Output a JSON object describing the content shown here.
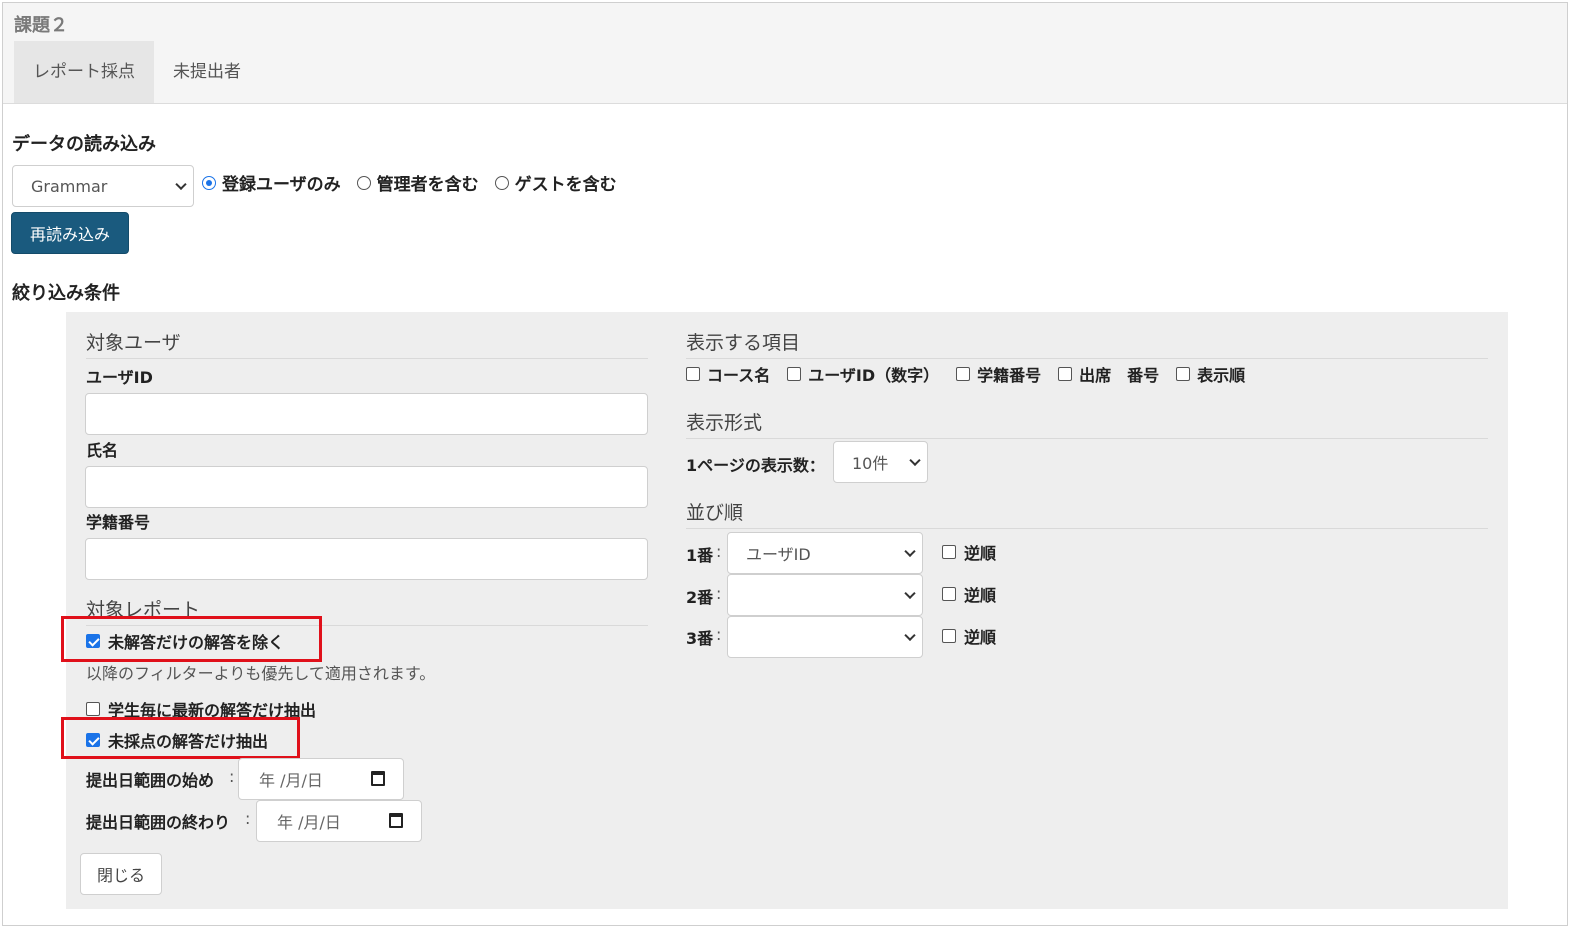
{
  "header": {
    "title": "課題２",
    "tabs": [
      {
        "label": "レポート採点",
        "active": true
      },
      {
        "label": "未提出者",
        "active": false
      }
    ]
  },
  "load": {
    "heading": "データの読み込み",
    "course_select": "Grammar",
    "radios": [
      {
        "label": "登録ユーザのみ",
        "checked": true
      },
      {
        "label": "管理者を含む",
        "checked": false
      },
      {
        "label": "ゲストを含む",
        "checked": false
      }
    ],
    "reload_button": "再読み込み"
  },
  "filter": {
    "heading": "絞り込み条件",
    "target_user": {
      "heading": "対象ユーザ",
      "user_id_label": "ユーザID",
      "user_id_value": "",
      "name_label": "氏名",
      "name_value": "",
      "student_no_label": "学籍番号",
      "student_no_value": ""
    },
    "target_report": {
      "heading": "対象レポート",
      "exclude_unanswered": {
        "label": "未解答だけの解答を除く",
        "checked": true
      },
      "note": "以降のフィルターよりも優先して適用されます。",
      "latest_only": {
        "label": "学生毎に最新の解答だけ抽出",
        "checked": false
      },
      "ungraded_only": {
        "label": "未採点の解答だけ抽出",
        "checked": true
      },
      "date_from_label": "提出日範囲の始め",
      "date_to_label": "提出日範囲の終わり",
      "date_placeholder": "年 /月/日",
      "colon": ":"
    },
    "close_button": "閉じる",
    "display_items": {
      "heading": "表示する項目",
      "options": [
        {
          "label": "コース名",
          "checked": false
        },
        {
          "label": "ユーザID（数字）",
          "checked": false
        },
        {
          "label": "学籍番号",
          "checked": false
        },
        {
          "label": "出席　番号",
          "checked": false
        },
        {
          "label": "表示順",
          "checked": false
        }
      ]
    },
    "display_format": {
      "heading": "表示形式",
      "per_page_label": "1ページの表示数：",
      "per_page_value": "10件"
    },
    "sort": {
      "heading": "並び順",
      "rows": [
        {
          "label": "1番",
          "value": "ユーザID",
          "reverse_label": "逆順",
          "reverse": false
        },
        {
          "label": "2番",
          "value": "",
          "reverse_label": "逆順",
          "reverse": false
        },
        {
          "label": "3番",
          "value": "",
          "reverse_label": "逆順",
          "reverse": false
        }
      ],
      "colon": ":"
    }
  }
}
